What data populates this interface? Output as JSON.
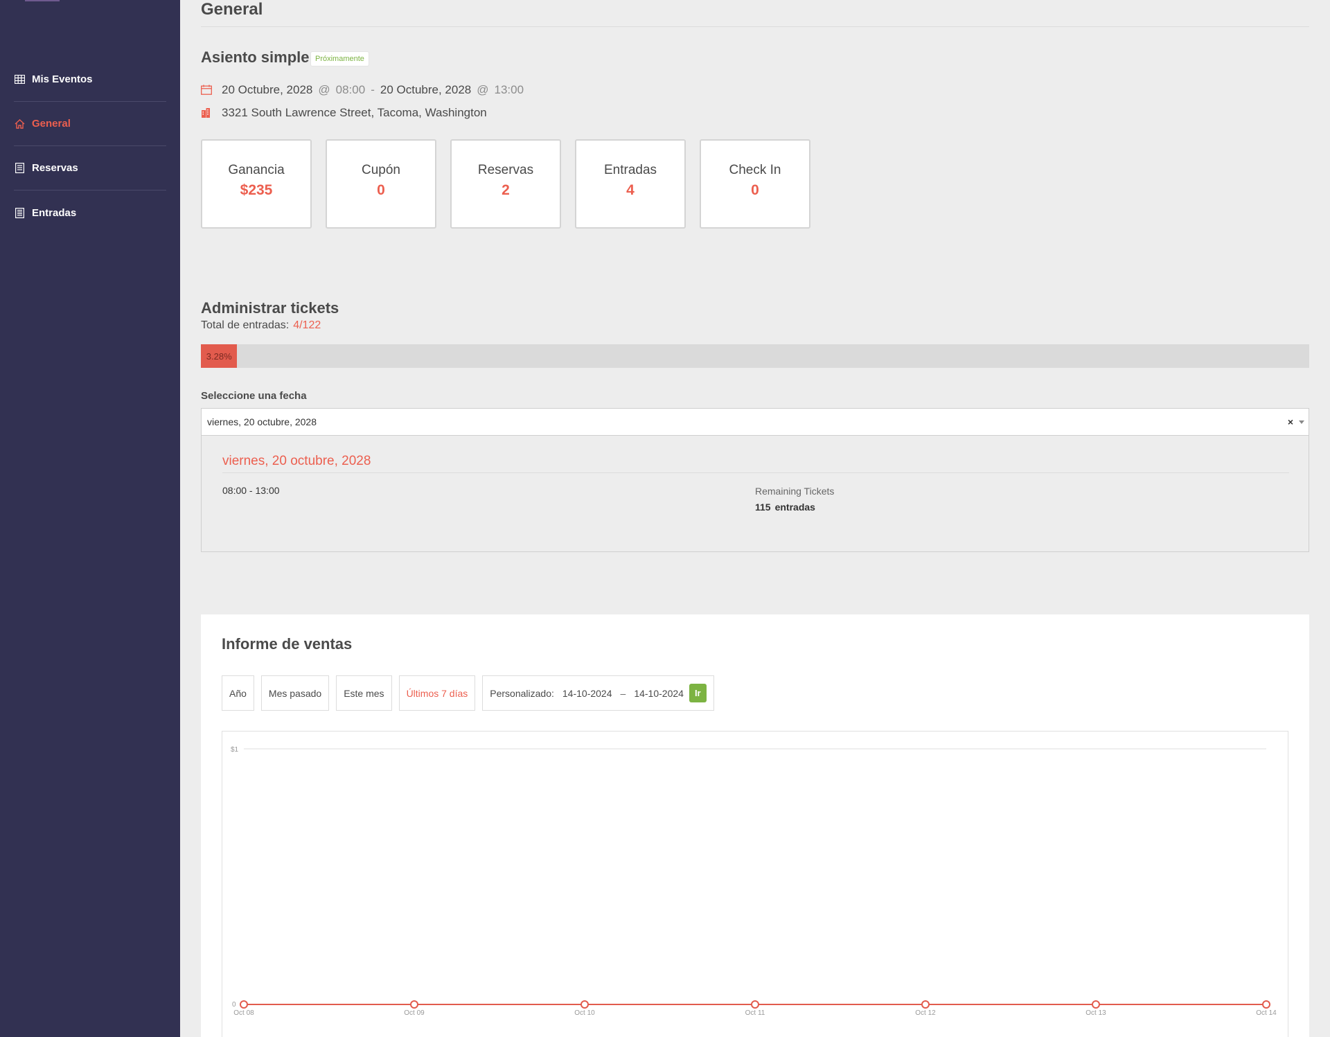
{
  "sidebar": {
    "items": [
      {
        "label": "Mis Eventos",
        "icon": "table-icon",
        "active": false
      },
      {
        "label": "General",
        "icon": "home-icon",
        "active": true
      },
      {
        "label": "Reservas",
        "icon": "list-icon",
        "active": false
      },
      {
        "label": "Entradas",
        "icon": "document-icon",
        "active": false
      }
    ]
  },
  "page": {
    "title": "General"
  },
  "event": {
    "name": "Asiento simple",
    "status": "Próximamente",
    "start_date": "20 Octubre, 2028",
    "start_time": "08:00",
    "end_date": "20 Octubre, 2028",
    "end_time": "13:00",
    "at": "@",
    "sep": "-",
    "address": "3321 South Lawrence Street, Tacoma, Washington"
  },
  "stats": [
    {
      "label": "Ganancia",
      "value": "$235"
    },
    {
      "label": "Cupón",
      "value": "0"
    },
    {
      "label": "Reservas",
      "value": "2"
    },
    {
      "label": "Entradas",
      "value": "4"
    },
    {
      "label": "Check In",
      "value": "0"
    }
  ],
  "tickets": {
    "title": "Administrar tickets",
    "total_label": "Total de entradas:",
    "total_value": "4/122",
    "progress_text": "3.28%",
    "progress_fraction": 0.0328,
    "select_label": "Seleccione una fecha",
    "selected_date": "viernes, 20 octubre, 2028",
    "clear": "×",
    "panel": {
      "date": "viernes, 20 octubre, 2028",
      "time": "08:00 - 13:00",
      "remaining_label": "Remaining Tickets",
      "remaining_count": "115",
      "remaining_unit": "entradas"
    }
  },
  "report": {
    "title": "Informe de ventas",
    "filters": [
      {
        "label": "Año",
        "active": false
      },
      {
        "label": "Mes pasado",
        "active": false
      },
      {
        "label": "Este mes",
        "active": false
      },
      {
        "label": "Últimos 7 días",
        "active": true
      }
    ],
    "custom": {
      "label": "Personalizado:",
      "from": "14-10-2024",
      "dash": "–",
      "to": "14-10-2024",
      "go": "Ir"
    }
  },
  "chart_data": {
    "type": "line",
    "categories": [
      "Oct 08",
      "Oct 09",
      "Oct 10",
      "Oct 11",
      "Oct 12",
      "Oct 13",
      "Oct 14"
    ],
    "values": [
      0,
      0,
      0,
      0,
      0,
      0,
      0
    ],
    "yticks": [
      "$1",
      "0"
    ],
    "ylim": [
      0,
      1
    ],
    "color": "#e25b4d",
    "grid": true
  }
}
